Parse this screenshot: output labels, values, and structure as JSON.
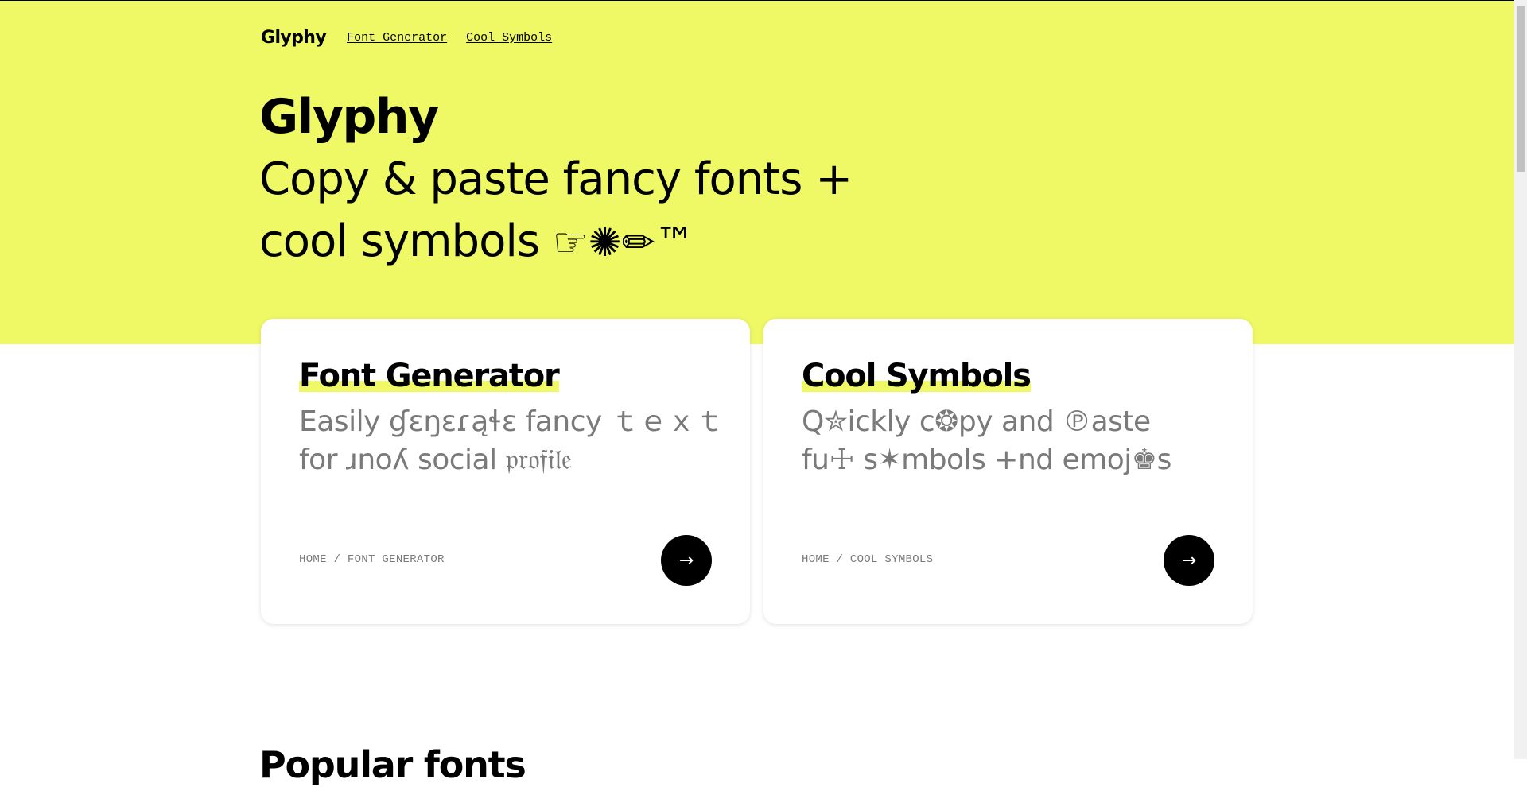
{
  "nav": {
    "brand": "Glyphy",
    "links": [
      "Font Generator",
      "Cool Symbols"
    ]
  },
  "hero": {
    "title": "Glyphy",
    "tagline_line1": "Copy & paste fancy fonts +",
    "tagline_line2_text": "cool symbols ",
    "tagline_symbols": "☞✺✏™"
  },
  "cards": [
    {
      "title": "Font Generator",
      "desc_line1": "Easily ɠɛŋɛɾąɬɛ fancy ｔｅｘｔ",
      "desc_line2": "for ɹnoʎ social 𝔭𝔯𝔬𝔣𝔦𝔩𝔢",
      "breadcrumb": "HOME / FONT GENERATOR",
      "arrow": "→"
    },
    {
      "title": "Cool Symbols",
      "desc_line1": "Q✮ickly c❂py and ℗aste",
      "desc_line2": "fu☩ s✶mbols +nd emoj♚s",
      "breadcrumb": "HOME / COOL SYMBOLS",
      "arrow": "→"
    }
  ],
  "next_section_heading": "Popular fonts",
  "colors": {
    "accent": "#eff966",
    "text": "#000000",
    "muted": "#7a7a7a",
    "button": "#000000"
  },
  "icons": {
    "arrow": "arrow-right-icon"
  }
}
